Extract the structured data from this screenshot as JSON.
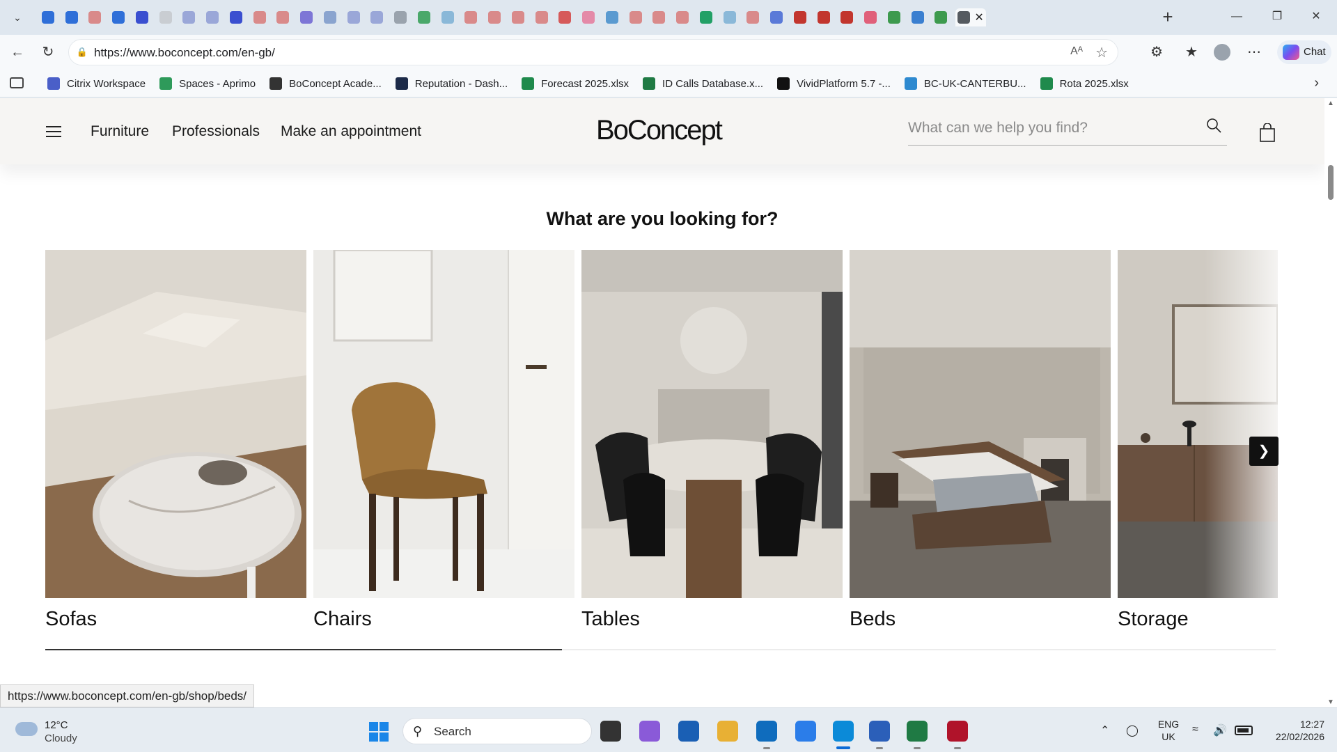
{
  "browser": {
    "tab_colors": [
      "#2f6fd8",
      "#2f6fd8",
      "#d98a8a",
      "#2f6fd8",
      "#3a4fd0",
      "#c9cdd2",
      "#9aa7d8",
      "#9aa7d8",
      "#3a4fd0",
      "#d98a8a",
      "#d98a8a",
      "#7d76d6",
      "#8aa4cf",
      "#9aa7d8",
      "#9aa7d8",
      "#9aa3ad",
      "#4aa86a",
      "#8ab8d8",
      "#d98a8a",
      "#d98a8a",
      "#d98a8a",
      "#d98a8a",
      "#d65a5a",
      "#e48aa8",
      "#5a9ad0",
      "#d98a8a",
      "#d98a8a",
      "#d98a8a",
      "#22a066",
      "#8ab8d8",
      "#d98a8a",
      "#5a7ad8",
      "#c2362e",
      "#c2362e",
      "#c2362e",
      "#e0607a",
      "#3d9a4e",
      "#3a7fd0",
      "#3d9a4e",
      "#555a60"
    ],
    "url": "https://www.boconcept.com/en-gb/",
    "reader_label": "Aᴬ",
    "copilot_label": "Chat",
    "bookmarks": [
      {
        "label": "Citrix Workspace",
        "color": "#4a5fc8"
      },
      {
        "label": "Spaces - Aprimo",
        "color": "#2e9a5a"
      },
      {
        "label": "BoConcept Acade...",
        "color": "#333333"
      },
      {
        "label": "Reputation - Dash...",
        "color": "#1c2a48"
      },
      {
        "label": "Forecast 2025.xlsx",
        "color": "#1f8a4c"
      },
      {
        "label": "ID Calls Database.x...",
        "color": "#1f7a44"
      },
      {
        "label": "VividPlatform 5.7 -...",
        "color": "#111111"
      },
      {
        "label": "BC-UK-CANTERBU...",
        "color": "#2e8ad0"
      },
      {
        "label": "Rota 2025.xlsx",
        "color": "#1f8a4c"
      }
    ]
  },
  "site": {
    "nav": [
      "Furniture",
      "Professionals",
      "Make an appointment"
    ],
    "logo": "BoConcept",
    "search_placeholder": "What can we help you find?",
    "section_heading": "What are you looking for?",
    "categories": [
      "Sofas",
      "Chairs",
      "Tables",
      "Beds",
      "Storage"
    ],
    "carousel_progress": 0.42,
    "status_url": "https://www.boconcept.com/en-gb/shop/beds/"
  },
  "taskbar": {
    "temperature": "12°C",
    "weather": "Cloudy",
    "search_label": "Search",
    "language": "ENG",
    "region": "UK",
    "time": "12:27",
    "date": "22/02/2026",
    "app_colors": [
      "#333333",
      "#8a5ad8",
      "#1a5fb4",
      "#e8b034",
      "#0f6cbd",
      "#2b7de9",
      "#0b8ad8",
      "#2b5fb9",
      "#1f7a44",
      "#b0132a"
    ]
  }
}
